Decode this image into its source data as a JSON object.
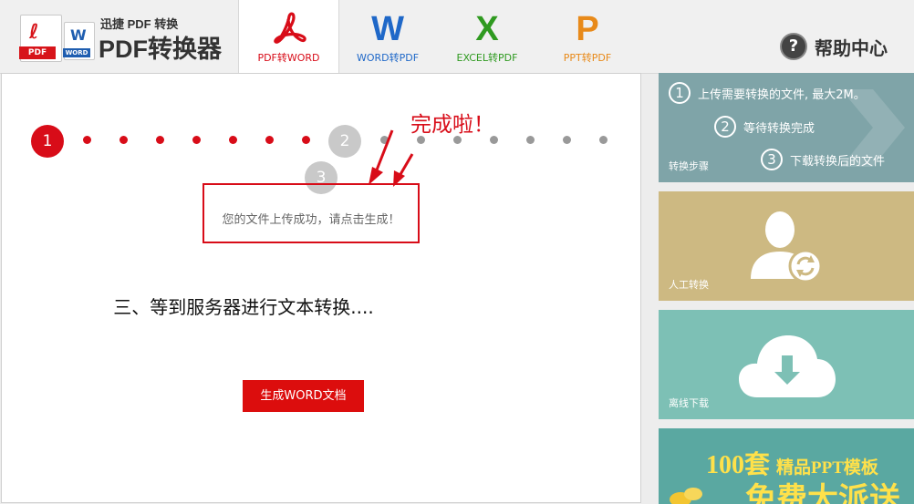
{
  "header": {
    "logo_subtitle": "迅捷 PDF 转换",
    "logo_title": "PDF转换器",
    "logo_pdf_badge": "PDF",
    "logo_word_badge": "WORD",
    "tabs": [
      {
        "glyph": "W",
        "label": "WORD转PDF",
        "color": "#1f68c8"
      },
      {
        "glyph": "X",
        "label": "EXCEL转PDF",
        "color": "#2f9a20"
      },
      {
        "glyph": "P",
        "label": "PPT转PDF",
        "color": "#e88a1a"
      }
    ],
    "active_tab": {
      "label": "PDF转WORD",
      "color": "#d80c18"
    },
    "help": {
      "icon": "?",
      "label": "帮助中心"
    }
  },
  "main": {
    "steps": [
      "1",
      "2",
      "3"
    ],
    "done_annotation": "完成啦！",
    "message": "您的文件上传成功，请点击生成！",
    "status_text": "三、等到服务器进行文本转换....",
    "generate_button": "生成WORD文档"
  },
  "sidebar": {
    "steps_panel": {
      "items": [
        {
          "num": "1",
          "text": "上传需要转换的文件, 最大2M。"
        },
        {
          "num": "2",
          "text": "等待转换完成"
        },
        {
          "num": "3",
          "text": "下载转换后的文件"
        }
      ],
      "label": "转换步骤"
    },
    "manual_panel": {
      "label": "人工转换"
    },
    "offline_panel": {
      "label": "离线下载"
    },
    "promo": {
      "number": "100套",
      "line1": "精品PPT模板",
      "line2": "免费大派送"
    }
  },
  "colors": {
    "accent_red": "#d80c18",
    "step_panel_bg": "#7fa4a8",
    "manual_panel_bg": "#cdb982",
    "offline_panel_bg": "#7dc0b5",
    "promo_bg": "#5aa8a1"
  },
  "icons": [
    "acrobat-icon",
    "word-icon",
    "excel-icon",
    "ppt-icon",
    "help-icon",
    "person-sync-icon",
    "cloud-download-icon",
    "chevron-right-icon",
    "arrow-annotation-icon"
  ]
}
